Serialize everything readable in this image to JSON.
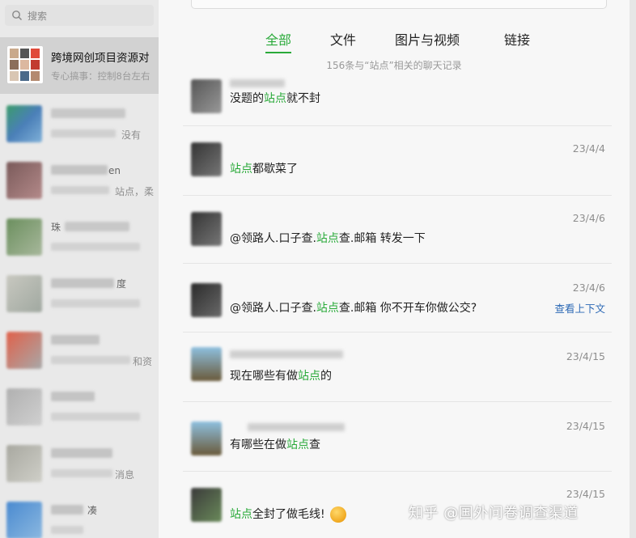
{
  "search": {
    "placeholder": "搜索"
  },
  "chat_list": {
    "selected": {
      "name": "跨境网创项目资源对",
      "preview": "专心搞事：控制8台左右"
    },
    "fragments": [
      "没有",
      "en",
      "站点，柔",
      "珠",
      "度",
      "和资",
      "消息",
      "凑"
    ]
  },
  "tabs": [
    {
      "label": "全部",
      "active": true
    },
    {
      "label": "文件",
      "active": false
    },
    {
      "label": "图片与视频",
      "active": false
    },
    {
      "label": "链接",
      "active": false
    }
  ],
  "summary": "156条与“站点”相关的聊天记录",
  "results": [
    {
      "before": "没题的",
      "keyword": "站点",
      "after": "就不封",
      "date": ""
    },
    {
      "before": "",
      "keyword": "站点",
      "after": "都歇菜了",
      "date": "23/4/4"
    },
    {
      "before": "@领路人.口子查.",
      "keyword": "站点",
      "after": "查.邮箱 转发一下",
      "date": "23/4/6"
    },
    {
      "before": "@领路人.口子查.",
      "keyword": "站点",
      "after": "查.邮箱 你不开车你做公交?",
      "date": "23/4/6",
      "link": "查看上下文"
    },
    {
      "before": "现在哪些有做",
      "keyword": "站点",
      "after": "的",
      "date": "23/4/15"
    },
    {
      "before": "有哪些在做",
      "keyword": "站点",
      "after": "查",
      "date": "23/4/15"
    },
    {
      "before": "",
      "keyword": "站点",
      "after": "全封了做毛线!",
      "date": "23/4/15",
      "emoji": "grin-emoji"
    }
  ],
  "watermark": "知乎 @国外问卷调查渠道",
  "colors": {
    "accent": "#2aaa3a",
    "link": "#2b68b5",
    "sidebar": "#e9e9e9",
    "selected_row": "#d2d2d2"
  }
}
